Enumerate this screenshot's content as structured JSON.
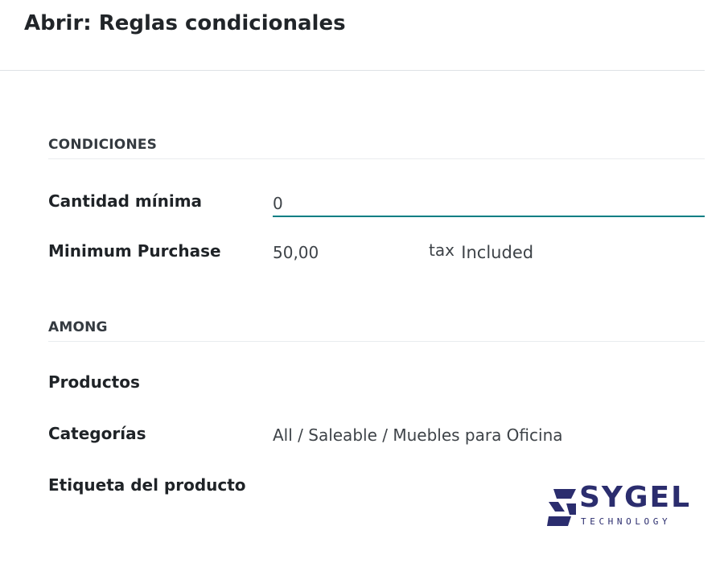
{
  "dialog": {
    "title": "Abrir: Reglas condicionales"
  },
  "conditions": {
    "section_title": "CONDICIONES",
    "min_quantity_label": "Cantidad mínima",
    "min_quantity_value": "0",
    "min_purchase_label": "Minimum Purchase",
    "min_purchase_value": "50,00",
    "tax_word": "tax",
    "tax_status": "Included"
  },
  "among": {
    "section_title": "AMONG",
    "products_label": "Productos",
    "products_value": "",
    "categories_label": "Categorías",
    "categories_value": "All / Saleable / Muebles para Oficina",
    "product_tag_label": "Etiqueta del producto",
    "product_tag_value": ""
  },
  "logo": {
    "name": "SYGEL",
    "tagline": "TECHNOLOGY",
    "brand_color": "#2b2d6e"
  },
  "colors": {
    "input_underline": "#017e84",
    "divider": "#dee2e6"
  }
}
